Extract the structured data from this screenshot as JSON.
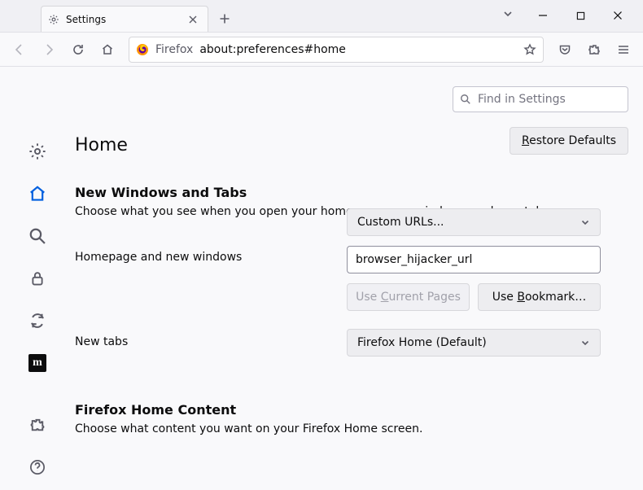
{
  "window": {
    "tab_title": "Settings",
    "identity_label": "Firefox",
    "url": "about:preferences#home"
  },
  "search": {
    "placeholder": "Find in Settings"
  },
  "page": {
    "title": "Home",
    "restore_defaults": "Restore Defaults"
  },
  "sections": {
    "nwat": {
      "title": "New Windows and Tabs",
      "desc": "Choose what you see when you open your homepage, new windows, and new tabs."
    },
    "fhc": {
      "title": "Firefox Home Content",
      "desc": "Choose what content you want on your Firefox Home screen."
    }
  },
  "home_form": {
    "homepage_label": "Homepage and new windows",
    "homepage_select": "Custom URLs...",
    "homepage_url": "browser_hijacker_url",
    "use_current": "Use Current Pages",
    "use_bookmark": "Use Bookmark…",
    "newtabs_label": "New tabs",
    "newtabs_select": "Firefox Home (Default)"
  }
}
